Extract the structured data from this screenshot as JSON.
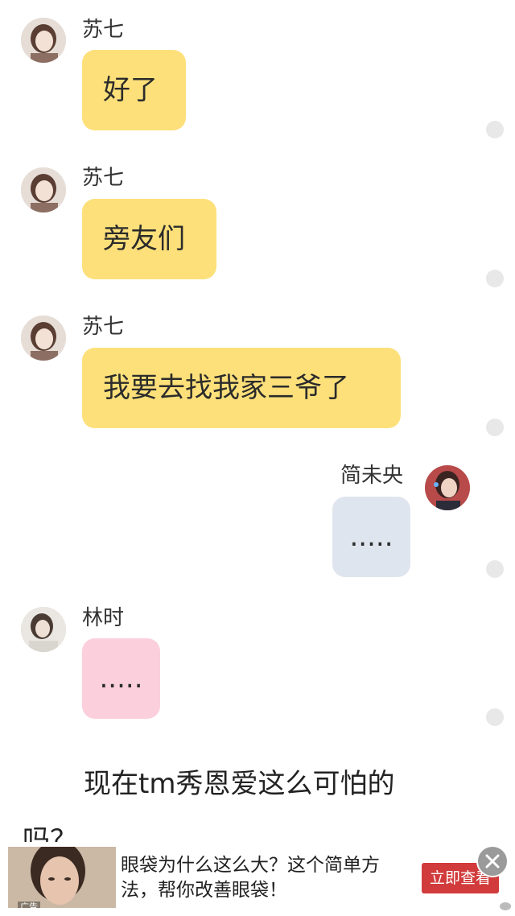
{
  "messages": [
    {
      "sender": "苏七",
      "text": "好了",
      "side": "left",
      "color": "yellow"
    },
    {
      "sender": "苏七",
      "text": "旁友们",
      "side": "left",
      "color": "yellow"
    },
    {
      "sender": "苏七",
      "text": "我要去找我家三爷了",
      "side": "left",
      "color": "yellow"
    },
    {
      "sender": "简未央",
      "text": ".....",
      "side": "right",
      "color": "blue"
    },
    {
      "sender": "林时",
      "text": ".....",
      "side": "left",
      "color": "pink"
    }
  ],
  "narration": {
    "line1": "现在tm秀恩爱这么可怕的",
    "line2": "吗？"
  },
  "ad": {
    "text": "眼袋为什么这么大？这个简单方法，帮你改善眼袋！",
    "button_label": "立即查看",
    "tag": "广告"
  },
  "colors": {
    "bubble_yellow": "#fde07a",
    "bubble_blue": "#dfe5ee",
    "bubble_pink": "#fccfdc",
    "ad_button": "#d23b3b"
  }
}
